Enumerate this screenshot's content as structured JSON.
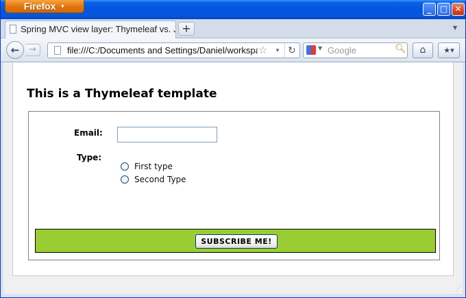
{
  "browser": {
    "menu_button": "Firefox",
    "tab_title": "Spring MVC view layer: Thymeleaf vs. JSP",
    "url": "file:///C:/Documents and Settings/Daniel/workspace/thymeleaf",
    "search_placeholder": "Google",
    "new_tab": "+",
    "window_controls": [
      "minimize",
      "maximize",
      "close"
    ]
  },
  "page": {
    "title": "This is a Thymeleaf template",
    "form": {
      "email_label": "Email:",
      "email_value": "",
      "type_label": "Type:",
      "type_options": [
        "First type",
        "Second Type"
      ],
      "submit_label": "SUBSCRIBE ME!"
    }
  },
  "colors": {
    "submit_bar": "#9acd32",
    "titlebar": "#0553e0",
    "firefox_button": "#e1740d"
  }
}
